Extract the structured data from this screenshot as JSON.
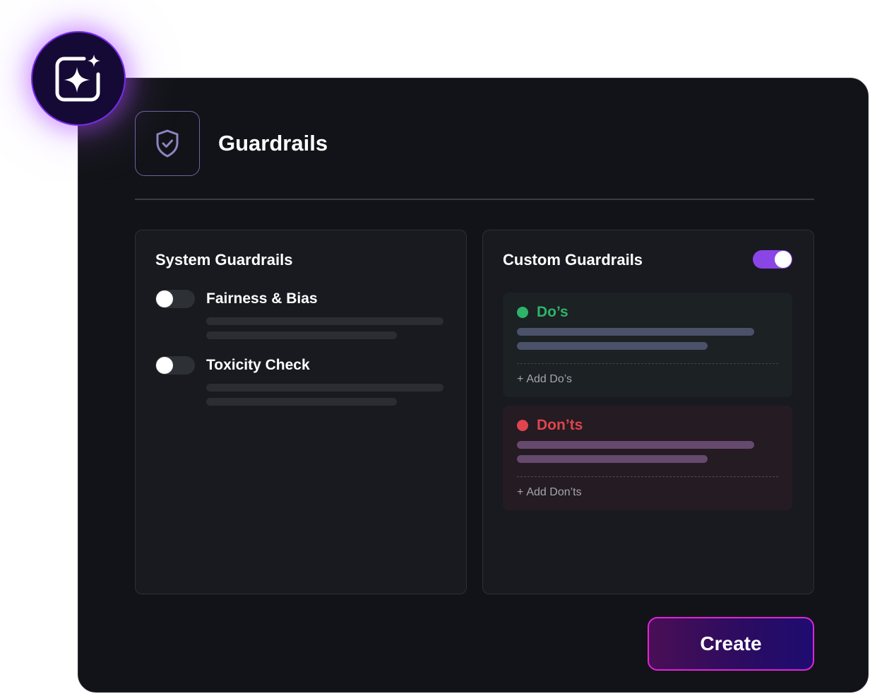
{
  "header": {
    "title": "Guardrails",
    "badge_icon": "sparkle-icon",
    "section_icon": "shield-check-icon"
  },
  "system_guardrails": {
    "title": "System Guardrails",
    "items": [
      {
        "label": "Fairness & Bias",
        "enabled": false
      },
      {
        "label": "Toxicity Check",
        "enabled": false
      }
    ]
  },
  "custom_guardrails": {
    "title": "Custom Guardrails",
    "enabled": true,
    "dos": {
      "title": "Do’s",
      "add_label": "Add Do’s",
      "color": "#2db36a"
    },
    "donts": {
      "title": "Don’ts",
      "add_label": "Add Don’ts",
      "color": "#e0444e"
    }
  },
  "actions": {
    "create_label": "Create"
  },
  "colors": {
    "accent": "#8a45e6",
    "button_border": "#e024d8",
    "panel_bg": "#121318"
  }
}
